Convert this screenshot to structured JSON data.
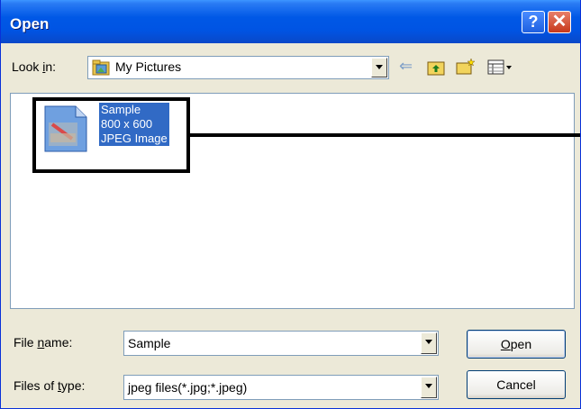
{
  "window": {
    "title": "Open",
    "help_glyph": "?",
    "close_glyph": "✕"
  },
  "lookin": {
    "label_pre": "Look ",
    "label_key": "i",
    "label_post": "n:",
    "value": "My Pictures",
    "tools": [
      "back-arrow-icon",
      "up-folder-icon",
      "new-folder-icon",
      "view-menu-icon"
    ]
  },
  "files": [
    {
      "name": "Sample",
      "dimensions": "800 x 600",
      "type": "JPEG Image",
      "selected": true
    }
  ],
  "filename": {
    "label_pre": "File ",
    "label_key": "n",
    "label_post": "ame:",
    "value": "Sample"
  },
  "filetype": {
    "label_pre": "Files of ",
    "label_key": "t",
    "label_post": "ype:",
    "value": "jpeg files(*.jpg;*.jpeg)"
  },
  "buttons": {
    "open_key": "O",
    "open_rest": "pen",
    "cancel": "Cancel"
  },
  "colors": {
    "titlebar": "#0054E3",
    "dialog_bg": "#ECE9D8",
    "selection": "#316AC5",
    "border": "#7F9DB9"
  }
}
